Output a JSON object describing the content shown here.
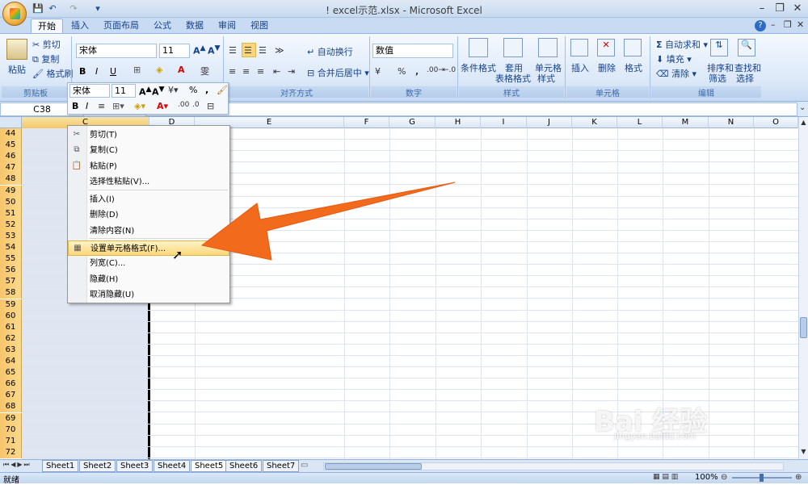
{
  "window": {
    "title": "! excel示范.xlsx - Microsoft Excel",
    "minimize": "–",
    "restore": "❐",
    "close": "✕",
    "help": "?"
  },
  "tabs": [
    "开始",
    "插入",
    "页面布局",
    "公式",
    "数据",
    "审阅",
    "视图"
  ],
  "ribbon": {
    "clipboard": {
      "paste": "粘贴",
      "cut": "剪切",
      "copy": "复制",
      "format_painter": "格式刷",
      "label": "剪贴板"
    },
    "font": {
      "name": "宋体",
      "size": "11",
      "label": "字体"
    },
    "alignment": {
      "wrap": "自动换行",
      "merge": "合并后居中",
      "label": "对齐方式"
    },
    "number": {
      "format": "数值",
      "label": "数字",
      "percent": "%",
      "comma": ","
    },
    "styles": {
      "conditional": "条件格式",
      "table1": "套用",
      "table2": "表格格式",
      "cell1": "单元格",
      "cell2": "样式",
      "label": "样式"
    },
    "cells": {
      "insert": "插入",
      "delete": "删除",
      "format": "格式",
      "label": "单元格"
    },
    "editing": {
      "autosum": "自动求和",
      "fill": "填充",
      "clear": "清除",
      "sort1": "排序和",
      "sort2": "筛选",
      "find1": "查找和",
      "find2": "选择",
      "label": "编辑"
    }
  },
  "namebox": "C38",
  "columns": [
    "C",
    "D",
    "E",
    "F",
    "G",
    "H",
    "I",
    "J",
    "K",
    "L",
    "M",
    "N",
    "O"
  ],
  "rows": [
    "44",
    "45",
    "46",
    "47",
    "48",
    "49",
    "50",
    "51",
    "52",
    "53",
    "54",
    "55",
    "56",
    "57",
    "58",
    "59",
    "60",
    "61",
    "62",
    "63",
    "64",
    "65",
    "66",
    "67",
    "68",
    "69",
    "70",
    "71",
    "72"
  ],
  "minibar": {
    "font": "宋体",
    "size": "11",
    "bold": "B",
    "italic": "I",
    "percent": "%",
    "comma": ","
  },
  "context_menu": [
    {
      "label": "剪切(T)",
      "icon": "scissors-icon",
      "glyph": "✂"
    },
    {
      "label": "复制(C)",
      "icon": "copy-icon",
      "glyph": "⧉"
    },
    {
      "label": "粘贴(P)",
      "icon": "paste-icon",
      "glyph": "📋"
    },
    {
      "label": "选择性粘贴(V)...",
      "icon": "",
      "glyph": ""
    },
    {
      "label": "插入(I)",
      "icon": "",
      "glyph": ""
    },
    {
      "label": "删除(D)",
      "icon": "",
      "glyph": ""
    },
    {
      "label": "清除内容(N)",
      "icon": "",
      "glyph": ""
    },
    {
      "label": "设置单元格格式(F)...",
      "icon": "format-cells-icon",
      "glyph": "▦"
    },
    {
      "label": "列宽(C)...",
      "icon": "",
      "glyph": ""
    },
    {
      "label": "隐藏(H)",
      "icon": "",
      "glyph": ""
    },
    {
      "label": "取消隐藏(U)",
      "icon": "",
      "glyph": ""
    }
  ],
  "sheets": [
    "Sheet1",
    "Sheet2",
    "Sheet3",
    "Sheet4",
    "Sheet5",
    "Sheet6",
    "Sheet7"
  ],
  "active_sheet": "Sheet5",
  "status": {
    "ready": "就绪",
    "zoom": "100%"
  },
  "watermark": {
    "main": "Bai 经验",
    "sub": "jingyan.baidu.com"
  },
  "colors": {
    "arrow": "#f26a1b",
    "row_header": "#f9d98c",
    "ribbon": "#dbe8f8"
  }
}
